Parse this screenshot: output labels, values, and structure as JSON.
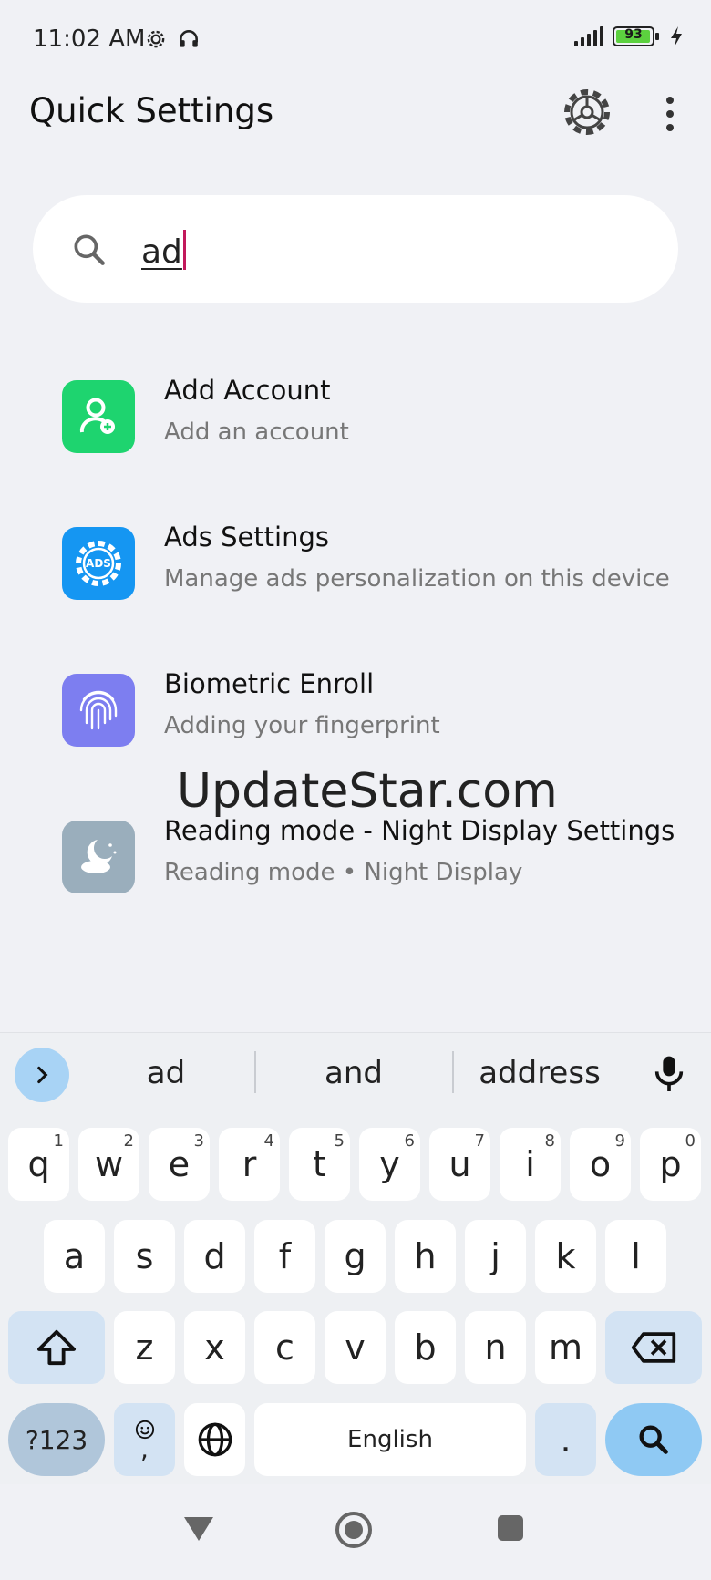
{
  "status": {
    "time": "11:02 AM",
    "battery": "93",
    "icons": [
      "gear-icon",
      "headphones-icon",
      "signal-icon",
      "battery-icon",
      "charging-icon"
    ]
  },
  "header": {
    "title": "Quick Settings",
    "icons": [
      "settings-gear-icon",
      "more-vert-icon"
    ]
  },
  "search": {
    "value": "ad",
    "icon": "search-icon"
  },
  "results": [
    {
      "title": "Add Account",
      "subtitle": "Add an account",
      "icon": "add-account-icon",
      "color": "#1ed46f"
    },
    {
      "title": "Ads Settings",
      "subtitle": "Manage ads personalization on this device",
      "icon": "ads-icon",
      "icon_text": "ADS",
      "color": "#1596f2"
    },
    {
      "title": "Biometric Enroll",
      "subtitle": "Adding your fingerprint",
      "icon": "fingerprint-icon",
      "color": "#7d7ef0"
    },
    {
      "title": "Reading mode - Night Display Settings",
      "subtitle": "Reading mode • Night Display",
      "icon": "night-mode-icon",
      "color": "#9aaebc"
    }
  ],
  "watermark": "UpdateStar.com",
  "keyboard": {
    "suggestions": [
      "ad",
      "and",
      "address"
    ],
    "row1": [
      {
        "k": "q",
        "h": "1"
      },
      {
        "k": "w",
        "h": "2"
      },
      {
        "k": "e",
        "h": "3"
      },
      {
        "k": "r",
        "h": "4"
      },
      {
        "k": "t",
        "h": "5"
      },
      {
        "k": "y",
        "h": "6"
      },
      {
        "k": "u",
        "h": "7"
      },
      {
        "k": "i",
        "h": "8"
      },
      {
        "k": "o",
        "h": "9"
      },
      {
        "k": "p",
        "h": "0"
      }
    ],
    "row2": [
      "a",
      "s",
      "d",
      "f",
      "g",
      "h",
      "j",
      "k",
      "l"
    ],
    "row3": [
      "z",
      "x",
      "c",
      "v",
      "b",
      "n",
      "m"
    ],
    "symbols_label": "?123",
    "emoji_comma": ",",
    "space_label": "English",
    "period_label": "."
  },
  "nav": {
    "icons": [
      "back-icon",
      "home-icon",
      "recents-icon"
    ]
  }
}
